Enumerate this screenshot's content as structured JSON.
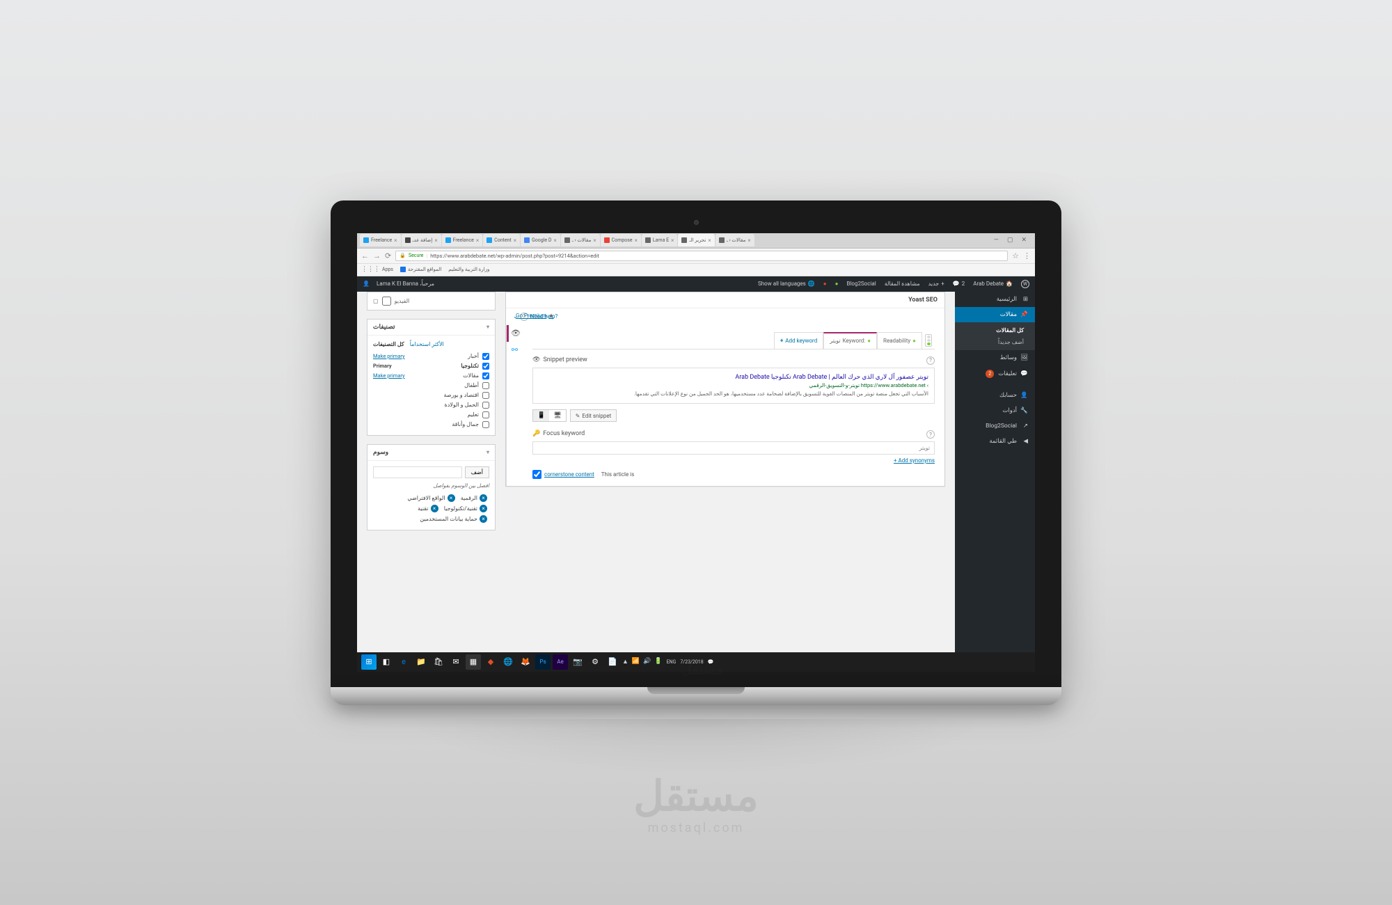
{
  "browser": {
    "tabs": [
      {
        "label": "Freelance",
        "icon": "#1da1f2"
      },
      {
        "label": "إضافة عدـ",
        "icon": "#444"
      },
      {
        "label": "Freelance",
        "icon": "#1da1f2"
      },
      {
        "label": "Content",
        "icon": "#1da1f2"
      },
      {
        "label": "Google D",
        "icon": "#4285f4"
      },
      {
        "label": "مقالات ‹ ـ",
        "icon": "#666"
      },
      {
        "label": "Compose",
        "icon": "#ea4335"
      },
      {
        "label": "Lama E",
        "icon": "#666"
      },
      {
        "label": "تحرير الـ",
        "icon": "#666",
        "active": true
      },
      {
        "label": "مقالات ‹ ـ",
        "icon": "#666"
      }
    ],
    "secure_label": "Secure",
    "url": "https://www.arabdebate.net/wp-admin/post.php?post=9214&action=edit",
    "bookmarks": {
      "apps": "Apps",
      "items": [
        "المواقع المقترحة",
        "وزارة التربية والتعليم"
      ]
    }
  },
  "adminbar": {
    "site": "Arab Debate",
    "comments": "2",
    "new": "جديد",
    "view": "مشاهدة المقالة",
    "b2s": "Blog2Social",
    "langs": "Show all languages",
    "greeting": "مرحباً،",
    "user": "Lama K El Banna"
  },
  "sidebar": {
    "items": [
      {
        "label": "الرئيسية",
        "icon": "dashboard"
      },
      {
        "label": "مقالات",
        "icon": "pin",
        "active": true
      },
      {
        "label": "وسائط",
        "icon": "media"
      },
      {
        "label": "تعليقات",
        "icon": "comment",
        "badge": "2"
      },
      {
        "label": "حسابك",
        "icon": "user"
      },
      {
        "label": "أدوات",
        "icon": "tools"
      },
      {
        "label": "Blog2Social",
        "icon": "share"
      },
      {
        "label": "طي القائمة",
        "icon": "collapse"
      }
    ],
    "submenu": [
      "كل المقالات",
      "أضف جديداً"
    ]
  },
  "yoast": {
    "title": "Yoast SEO",
    "help": "?Need help",
    "premium": "Go Premium",
    "tabs": {
      "readability": "Readability",
      "keyword_label": ":Keyword",
      "keyword_value": "تويتر",
      "add": "Add keyword"
    },
    "snippet": {
      "section": "Snippet preview",
      "title": "تويتر عصفور آل لاري الذي حرك العالم | Arab Debate تكنلوجيا Arab Debate",
      "url_prefix": "https://www.arabdebate.net ‹",
      "url_slug": "تويتر-و-التسويق-الرقمي",
      "desc": "الأسباب التي تجعل منصة تويتر من المنصات القوية للتسويق بالإضافة لضخامة عدد مستخدميها، هو الحد الجميل من نوع الإعلانات التي تقدمها.",
      "edit": "Edit snippet"
    },
    "focus": {
      "section": "Focus keyword",
      "value": "تويتر",
      "synonyms": "Add synonyms",
      "cornerstone_pre": "This article is",
      "cornerstone_link": "cornerstone content"
    }
  },
  "sideboxes": {
    "video": "الفيديو",
    "categories": {
      "title": "تصنيفات",
      "tab_all": "كل التصنيفات",
      "tab_used": "الأكثر استخداماً",
      "items": [
        {
          "label": "أخبار",
          "checked": true,
          "action": "Make primary"
        },
        {
          "label": "تكنلوجيا",
          "checked": true,
          "action_label": "Primary",
          "sub_action": "Make primary"
        },
        {
          "label": "مقالات",
          "checked": true
        },
        {
          "label": "أطفال",
          "checked": false
        },
        {
          "label": "اقتصاد و بورصة",
          "checked": false
        },
        {
          "label": "الحمل و الولادة",
          "checked": false
        },
        {
          "label": "تعليم",
          "checked": false
        },
        {
          "label": "جمال وأناقة",
          "checked": false
        }
      ]
    },
    "tags": {
      "title": "وسوم",
      "add_btn": "أضف",
      "hint": "افصل بين الوسوم بفواصل",
      "items": [
        "الرقمية",
        "الواقع الافتراضي",
        "تقنية/تكنولوجيا",
        "تقنية",
        "حماية بيانات المستخدمين"
      ]
    }
  },
  "taskbar": {
    "date": "7/23/2018",
    "lang": "ENG"
  },
  "watermark": {
    "ar": "مستقل",
    "en": "mostaql.com"
  }
}
